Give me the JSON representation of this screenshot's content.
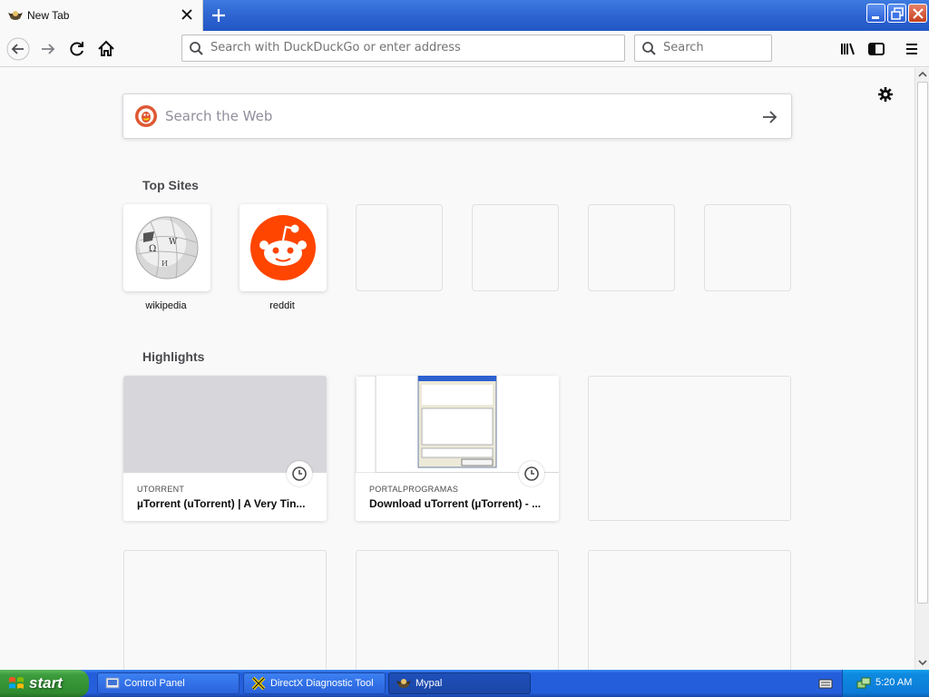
{
  "window": {
    "tab_title": "New Tab"
  },
  "navbar": {
    "url_placeholder": "Search with DuckDuckGo or enter address",
    "search_placeholder": "Search"
  },
  "newtab": {
    "web_search_placeholder": "Search the Web",
    "top_sites_title": "Top Sites",
    "top_sites": [
      {
        "label": "wikipedia",
        "icon": "wikipedia-globe-icon"
      },
      {
        "label": "reddit",
        "icon": "reddit-alien-icon"
      },
      {
        "label": ""
      },
      {
        "label": ""
      },
      {
        "label": ""
      },
      {
        "label": ""
      }
    ],
    "highlights_title": "Highlights",
    "highlights": [
      {
        "host": "UTORRENT",
        "title": "µTorrent (uTorrent) | A Very Tin..."
      },
      {
        "host": "PORTALPROGRAMAS",
        "title": "Download uTorrent (µTorrent) - ..."
      }
    ]
  },
  "taskbar": {
    "start_label": "start",
    "tasks": [
      {
        "label": "Control Panel"
      },
      {
        "label": "DirectX Diagnostic Tool"
      },
      {
        "label": "Mypal"
      }
    ],
    "clock": "5:20 AM"
  },
  "colors": {
    "accent": "#0060df",
    "reddit": "#ff4500",
    "xp_blue": "#245edb",
    "xp_start_green": "#3c9c3c"
  }
}
